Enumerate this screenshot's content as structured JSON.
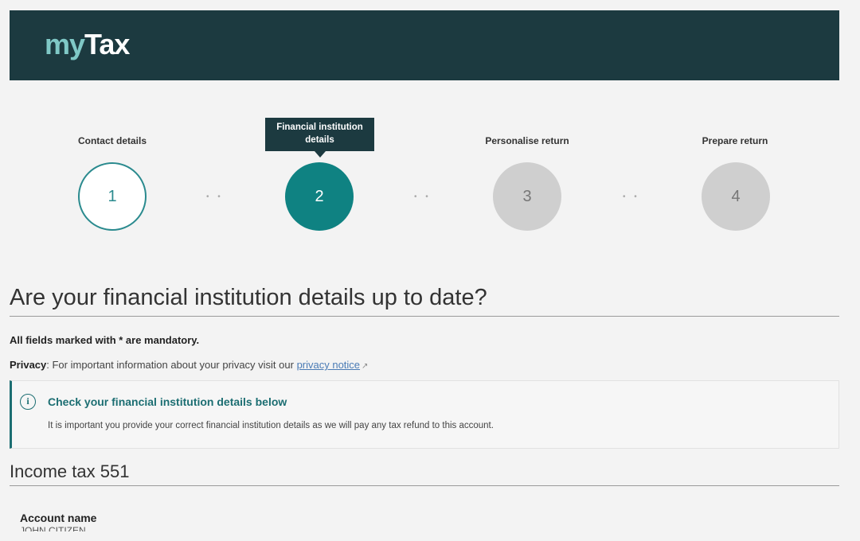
{
  "header": {
    "logo_my": "my",
    "logo_tax": "Tax"
  },
  "stepper": {
    "steps": [
      {
        "label": "Contact details",
        "number": "1"
      },
      {
        "label": "Financial institution details",
        "number": "2"
      },
      {
        "label": "Personalise return",
        "number": "3"
      },
      {
        "label": "Prepare return",
        "number": "4"
      }
    ],
    "active_tooltip_line1": "Financial institution",
    "active_tooltip_line2": "details",
    "connector": "• •"
  },
  "main": {
    "title": "Are your financial institution details up to date?",
    "mandatory_note": "All fields marked with * are mandatory.",
    "privacy_label": "Privacy",
    "privacy_text": ": For important information about your privacy visit our ",
    "privacy_link": "privacy notice"
  },
  "notice": {
    "title": "Check your financial institution details below",
    "body": "It is important you provide your correct financial institution details as we will pay any tax refund to this account."
  },
  "section": {
    "title": "Income tax 551",
    "account_name_label": "Account name",
    "account_name_value": "JOHN CITIZEN"
  },
  "colors": {
    "header_bg": "#1c3a40",
    "accent": "#0f8282",
    "inactive": "#cfcfcf"
  }
}
